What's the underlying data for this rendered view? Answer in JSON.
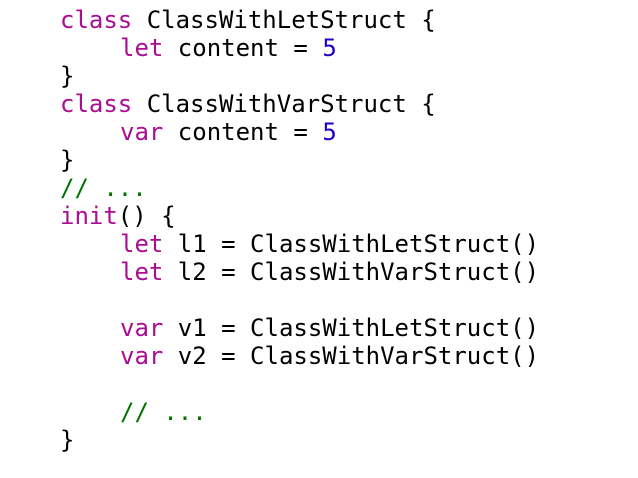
{
  "code": {
    "lines": [
      {
        "indent": 0,
        "tokens": [
          {
            "kind": "kw",
            "text": "class"
          },
          {
            "kind": "plain",
            "text": " ClassWithLetStruct {"
          }
        ]
      },
      {
        "indent": 1,
        "tokens": [
          {
            "kind": "kw",
            "text": "let"
          },
          {
            "kind": "plain",
            "text": " content = "
          },
          {
            "kind": "num",
            "text": "5"
          }
        ]
      },
      {
        "indent": 0,
        "tokens": [
          {
            "kind": "plain",
            "text": "}"
          }
        ]
      },
      {
        "indent": 0,
        "tokens": [
          {
            "kind": "kw",
            "text": "class"
          },
          {
            "kind": "plain",
            "text": " ClassWithVarStruct {"
          }
        ]
      },
      {
        "indent": 1,
        "tokens": [
          {
            "kind": "kw",
            "text": "var"
          },
          {
            "kind": "plain",
            "text": " content = "
          },
          {
            "kind": "num",
            "text": "5"
          }
        ]
      },
      {
        "indent": 0,
        "tokens": [
          {
            "kind": "plain",
            "text": "}"
          }
        ]
      },
      {
        "indent": 0,
        "tokens": [
          {
            "kind": "cmt",
            "text": "// ..."
          }
        ]
      },
      {
        "indent": 0,
        "tokens": [
          {
            "kind": "kw",
            "text": "init"
          },
          {
            "kind": "plain",
            "text": "() {"
          }
        ]
      },
      {
        "indent": 1,
        "tokens": [
          {
            "kind": "kw",
            "text": "let"
          },
          {
            "kind": "plain",
            "text": " l1 = ClassWithLetStruct()"
          }
        ]
      },
      {
        "indent": 1,
        "tokens": [
          {
            "kind": "kw",
            "text": "let"
          },
          {
            "kind": "plain",
            "text": " l2 = ClassWithVarStruct()"
          }
        ]
      },
      {
        "indent": 0,
        "tokens": []
      },
      {
        "indent": 1,
        "tokens": [
          {
            "kind": "kw",
            "text": "var"
          },
          {
            "kind": "plain",
            "text": " v1 = ClassWithLetStruct()"
          }
        ]
      },
      {
        "indent": 1,
        "tokens": [
          {
            "kind": "kw",
            "text": "var"
          },
          {
            "kind": "plain",
            "text": " v2 = ClassWithVarStruct()"
          }
        ]
      },
      {
        "indent": 0,
        "tokens": []
      },
      {
        "indent": 1,
        "tokens": [
          {
            "kind": "cmt",
            "text": "// ..."
          }
        ]
      },
      {
        "indent": 0,
        "tokens": [
          {
            "kind": "plain",
            "text": "}"
          }
        ]
      }
    ]
  },
  "colors": {
    "background": "#ffffff",
    "keyword": "#aa0d91",
    "number": "#1c00cf",
    "comment": "#007400",
    "plain": "#000000"
  }
}
